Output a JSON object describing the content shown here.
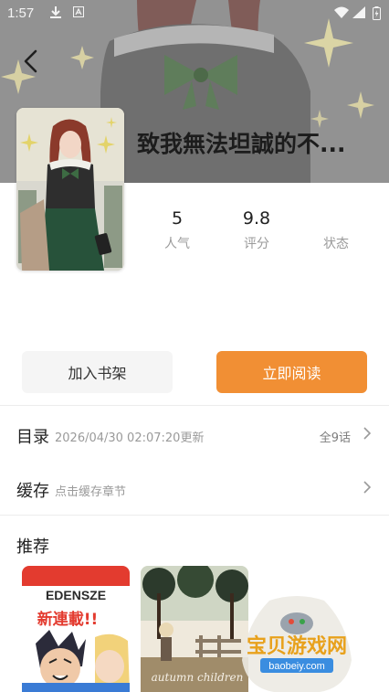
{
  "status_bar": {
    "time": "1:57"
  },
  "header": {
    "title": "致我無法坦誠的不..."
  },
  "stats": [
    {
      "value": "5",
      "label": "人气"
    },
    {
      "value": "9.8",
      "label": "评分"
    },
    {
      "value": "",
      "label": "状态"
    }
  ],
  "actions": {
    "shelf_label": "加入书架",
    "read_label": "立即阅读"
  },
  "catalog": {
    "label": "目录",
    "updated": "2026/04/30 02:07:20更新",
    "count": "全9话"
  },
  "cache": {
    "label": "缓存",
    "hint": "点击缓存章节"
  },
  "recommend": {
    "label": "推荐",
    "items": [
      {
        "cover_text_top": "EDENSZE",
        "cover_text_mid": "新連載!!"
      },
      {
        "cover_text_mid": "autumn children"
      }
    ]
  },
  "watermark": {
    "text": "宝贝游戏网",
    "url": "baobeiy.com"
  },
  "colors": {
    "accent": "#f18f34",
    "secondary_button": "#f5f5f5",
    "muted_text": "#9a9a9a",
    "banner": "#8c8c8c"
  }
}
